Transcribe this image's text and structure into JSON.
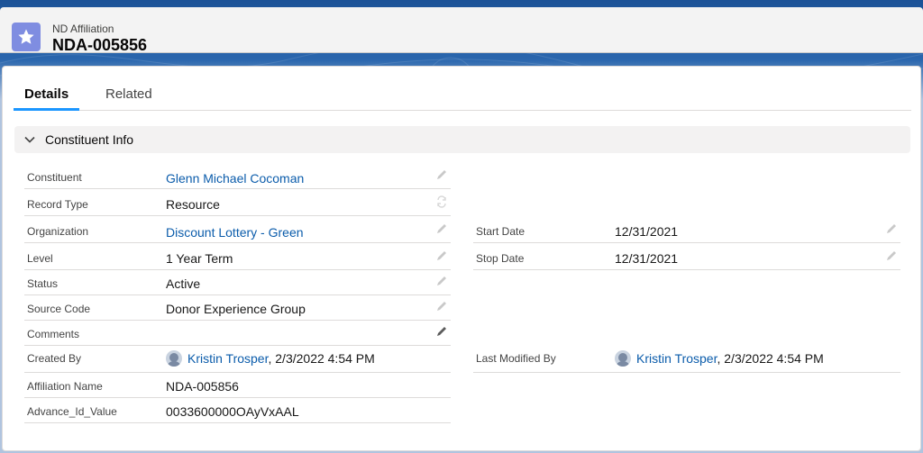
{
  "header": {
    "object_label": "ND Affiliation",
    "record_name": "NDA-005856",
    "icon": "star-icon"
  },
  "tabs": [
    {
      "label": "Details",
      "active": true
    },
    {
      "label": "Related",
      "active": false
    }
  ],
  "section": {
    "title": "Constituent Info",
    "expanded": true
  },
  "fields_left": [
    {
      "label": "Constituent",
      "value": "Glenn Michael Cocoman",
      "link": true,
      "editable": true
    },
    {
      "label": "Record Type",
      "value": "Resource",
      "link": false,
      "editable": false
    },
    {
      "label": "Organization",
      "value": "Discount Lottery - Green",
      "link": true,
      "editable": true
    },
    {
      "label": "Level",
      "value": "1 Year Term",
      "link": false,
      "editable": true
    },
    {
      "label": "Status",
      "value": "Active",
      "link": false,
      "editable": true
    },
    {
      "label": "Source Code",
      "value": "Donor Experience Group",
      "link": false,
      "editable": true
    },
    {
      "label": "Comments",
      "value": "",
      "link": false,
      "editable": true
    },
    {
      "label": "Created By",
      "user": "Kristin Trosper",
      "date": ", 2/3/2022 4:54 PM",
      "editable": false
    },
    {
      "label": "Affiliation Name",
      "value": "NDA-005856",
      "link": false,
      "editable": false
    },
    {
      "label": "Advance_Id_Value",
      "value": "0033600000OAyVxAAL",
      "link": false,
      "editable": false
    }
  ],
  "fields_right": [
    {
      "label": "Start Date",
      "value": "12/31/2021",
      "editable": true
    },
    {
      "label": "Stop Date",
      "value": "12/31/2021",
      "editable": true
    },
    {
      "label": "Last Modified By",
      "user": "Kristin Trosper",
      "date": ", 2/3/2022 4:54 PM",
      "editable": false
    }
  ],
  "colors": {
    "brand_band": "#1b5297",
    "link": "#0b5cab",
    "tab_active": "#1b96ff",
    "icon_bg": "#7f8de1"
  }
}
